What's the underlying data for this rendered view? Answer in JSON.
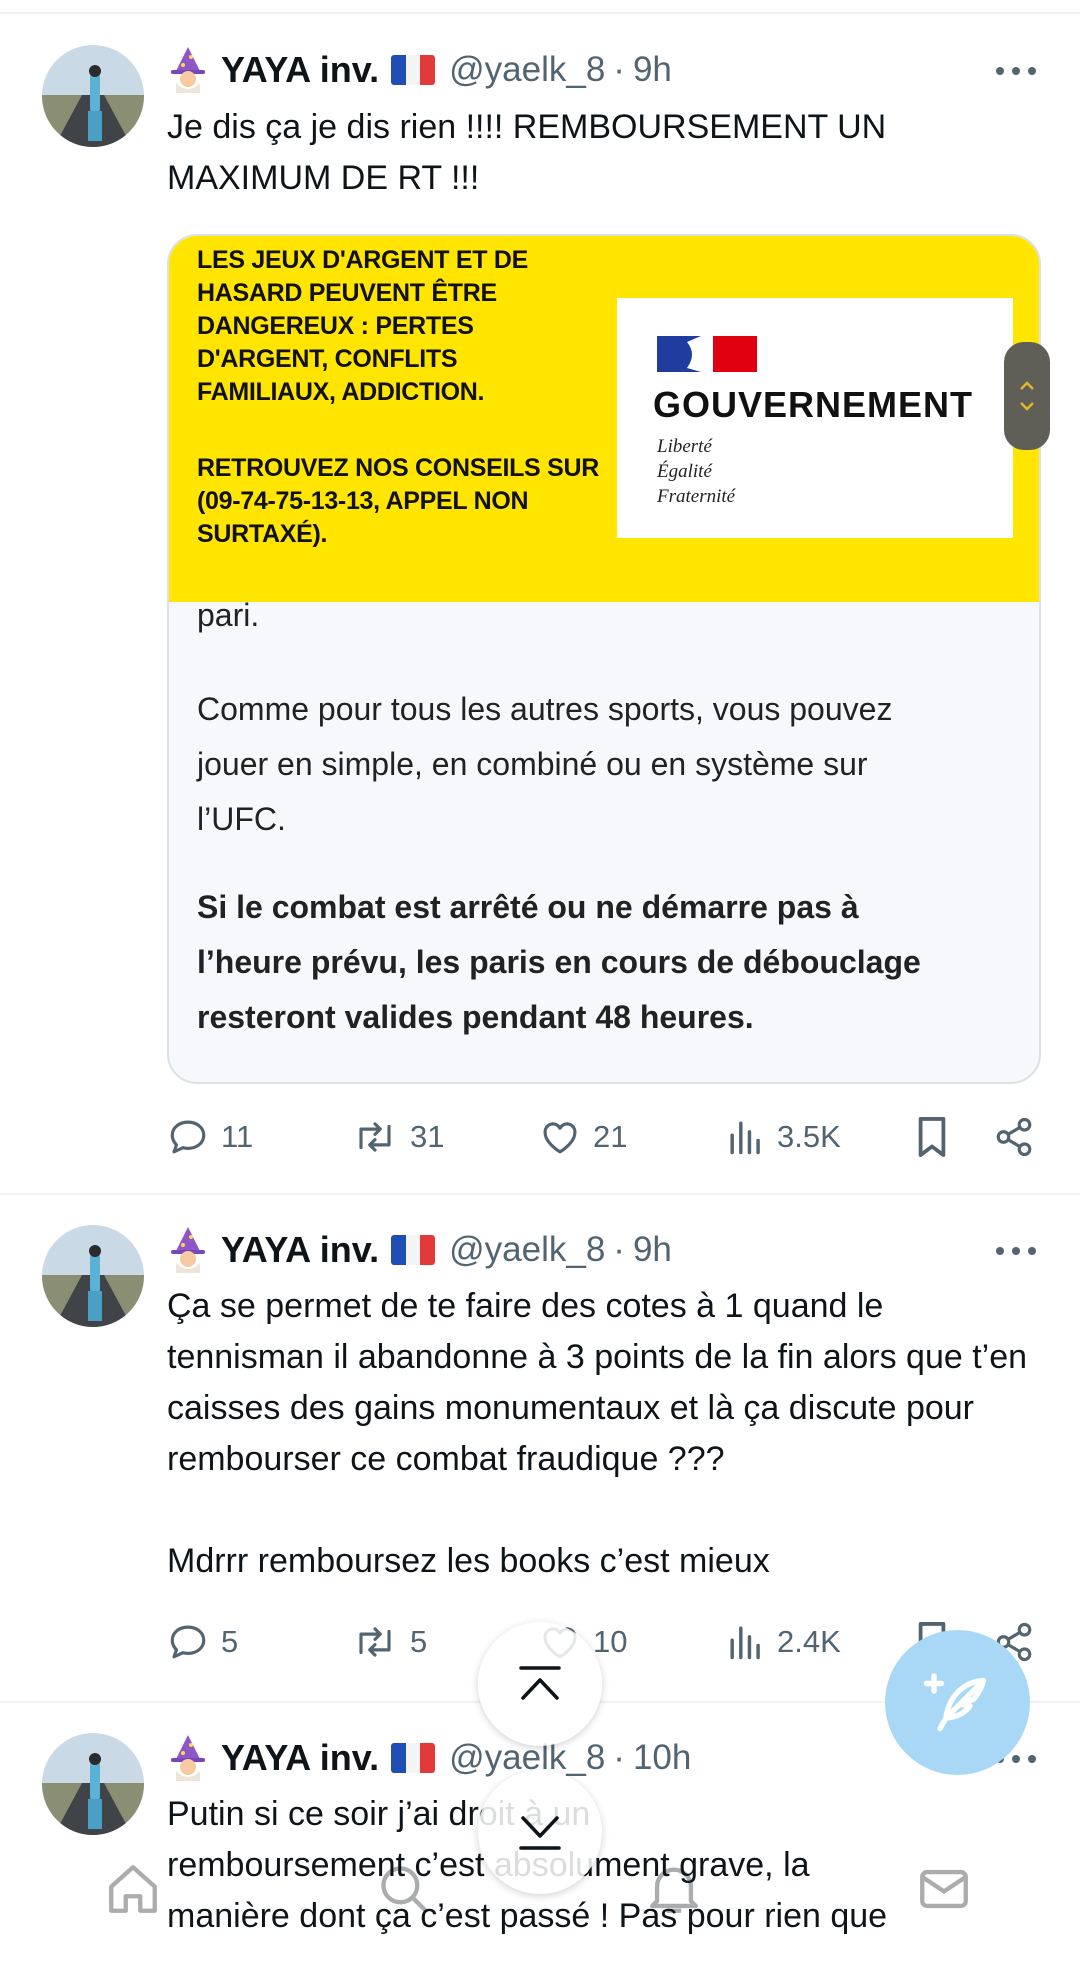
{
  "tweets": [
    {
      "name": "YAYA inv.",
      "handle": "@yaelk_8",
      "separator": "·",
      "time": "9h",
      "text": "Je dis ça je dis rien !!!! REMBOURSEMENT UN MAXIMUM DE RT !!!",
      "media": {
        "warning_text": "LES JEUX D'ARGENT ET DE\nHASARD PEUVENT ÊTRE\nDANGEREUX : PERTES\nD'ARGENT, CONFLITS\nFAMILIAUX, ADDICTION.",
        "advice_text": "RETROUVEZ NOS CONSEILS SUR\n(09-74-75-13-13, APPEL NON\nSURTAXÉ).",
        "gov_title": "GOUVERNEMENT",
        "gov_motto": "Liberté\nÉgalité\nFraternité",
        "partial_text": "pari.",
        "paragraph": "Comme pour tous les autres sports, vous pouvez\njouer en simple, en combiné ou en système sur\nl’UFC.",
        "bold_paragraph": "Si le combat est arrêté ou ne démarre pas à\nl’heure prévu, les paris en cours de débouclage\nresteront valides pendant 48 heures."
      },
      "stats": {
        "replies": "11",
        "retweets": "31",
        "likes": "21",
        "views": "3.5K"
      }
    },
    {
      "name": "YAYA inv.",
      "handle": "@yaelk_8",
      "separator": "·",
      "time": "9h",
      "text": "Ça se permet de te faire des cotes à 1 quand le tennisman il abandonne à 3 points de la fin alors que t’en caisses des gains monumentaux et là ça discute pour rembourser ce combat fraudique ???\n\nMdrrr remboursez les books c’est mieux",
      "stats": {
        "replies": "5",
        "retweets": "5",
        "likes": "10",
        "views": "2.4K"
      }
    },
    {
      "name": "YAYA inv.",
      "handle": "@yaelk_8",
      "separator": "·",
      "time": "10h",
      "text": "Putin si ce soir j’ai droit à un\nremboursement c’est absolument grave, la\nmanière dont ça c’est passé ! Pas pour rien que"
    }
  ],
  "colors": {
    "accent": "#1d9bf0",
    "muted": "#536471",
    "banner": "#ffe500",
    "fab": "#a9d8f6"
  },
  "icons": {
    "reply": "reply-icon",
    "retweet": "retweet-icon",
    "like": "heart-icon",
    "views": "views-icon",
    "bookmark": "bookmark-icon",
    "share": "share-icon",
    "compose": "compose-icon",
    "scroll_top": "scroll-top-icon",
    "scroll_down": "scroll-down-icon"
  }
}
